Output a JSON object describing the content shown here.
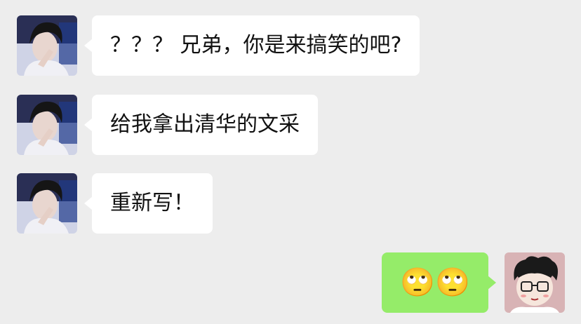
{
  "chat": {
    "messages": [
      {
        "sender": "friend",
        "text": "？？？ 兄弟，你是来搞笑的吧?"
      },
      {
        "sender": "friend",
        "text": "给我拿出清华的文采"
      },
      {
        "sender": "friend",
        "text": "重新写！"
      },
      {
        "sender": "me",
        "text": "🙄🙄"
      }
    ]
  },
  "colors": {
    "background": "#ededed",
    "incoming_bubble": "#ffffff",
    "outgoing_bubble": "#95ec69"
  },
  "icons": {
    "friend_avatar": "person-photo-avatar",
    "my_avatar": "cartoon-avatar"
  }
}
